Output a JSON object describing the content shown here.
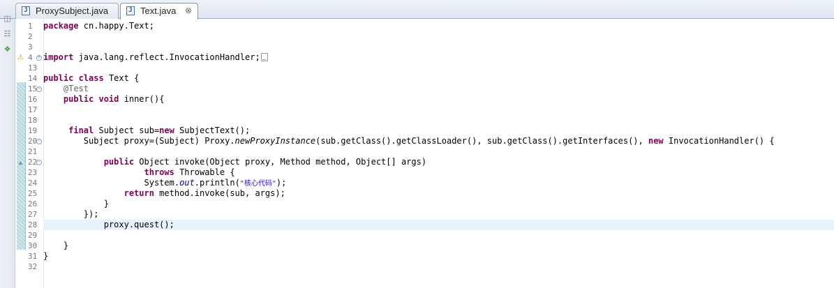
{
  "tabs": [
    {
      "label": "ProxySubject.java",
      "active": false,
      "icon": "java-file-icon"
    },
    {
      "label": "Text.java",
      "active": true,
      "icon": "java-file-icon",
      "close": "⊗"
    }
  ],
  "sidebar_icons": [
    "restore-icon",
    "outline-icon",
    "hierarchy-icon"
  ],
  "editor": {
    "line_numbers": [
      "1",
      "2",
      "3",
      "4",
      "13",
      "14",
      "15",
      "16",
      "17",
      "18",
      "19",
      "20",
      "21",
      "22",
      "23",
      "24",
      "25",
      "26",
      "27",
      "28",
      "29",
      "30",
      "31",
      "32"
    ],
    "code": {
      "l1_kw": "package",
      "l1_rest": " cn.happy.Text;",
      "l4_kw": "import",
      "l4_rest": " java.lang.reflect.InvocationHandler;",
      "l14_kw1": "public",
      "l14_kw2": "class",
      "l14_rest": " Text {",
      "l15_ann": "    @Test",
      "l16_kw1": "    public",
      "l16_kw2": "void",
      "l16_rest": " inner(){",
      "l19_kw": "     final",
      "l19_rest1": " Subject sub=",
      "l19_kw2": "new",
      "l19_rest2": " SubjectText();",
      "l20_pre": "        Subject proxy=(Subject) Proxy.",
      "l20_static": "newProxyInstance",
      "l20_mid": "(sub.getClass().getClassLoader(), sub.getClass().getInterfaces(), ",
      "l20_kw": "new",
      "l20_post": " InvocationHandler() {",
      "l22_kw": "            public",
      "l22_rest": " Object invoke(Object proxy, Method method, Object[] args)",
      "l23_kw": "                    throws",
      "l23_rest": " Throwable {",
      "l24_pre": "                    System.",
      "l24_field": "out",
      "l24_mid": ".println(",
      "l24_str": "\"核心代码\"",
      "l24_post": ");",
      "l25_kw": "                return",
      "l25_rest": " method.invoke(sub, args);",
      "l26": "            }",
      "l27": "        });",
      "l28": "            proxy.quest();",
      "l30": "    }",
      "l31": "}"
    }
  }
}
